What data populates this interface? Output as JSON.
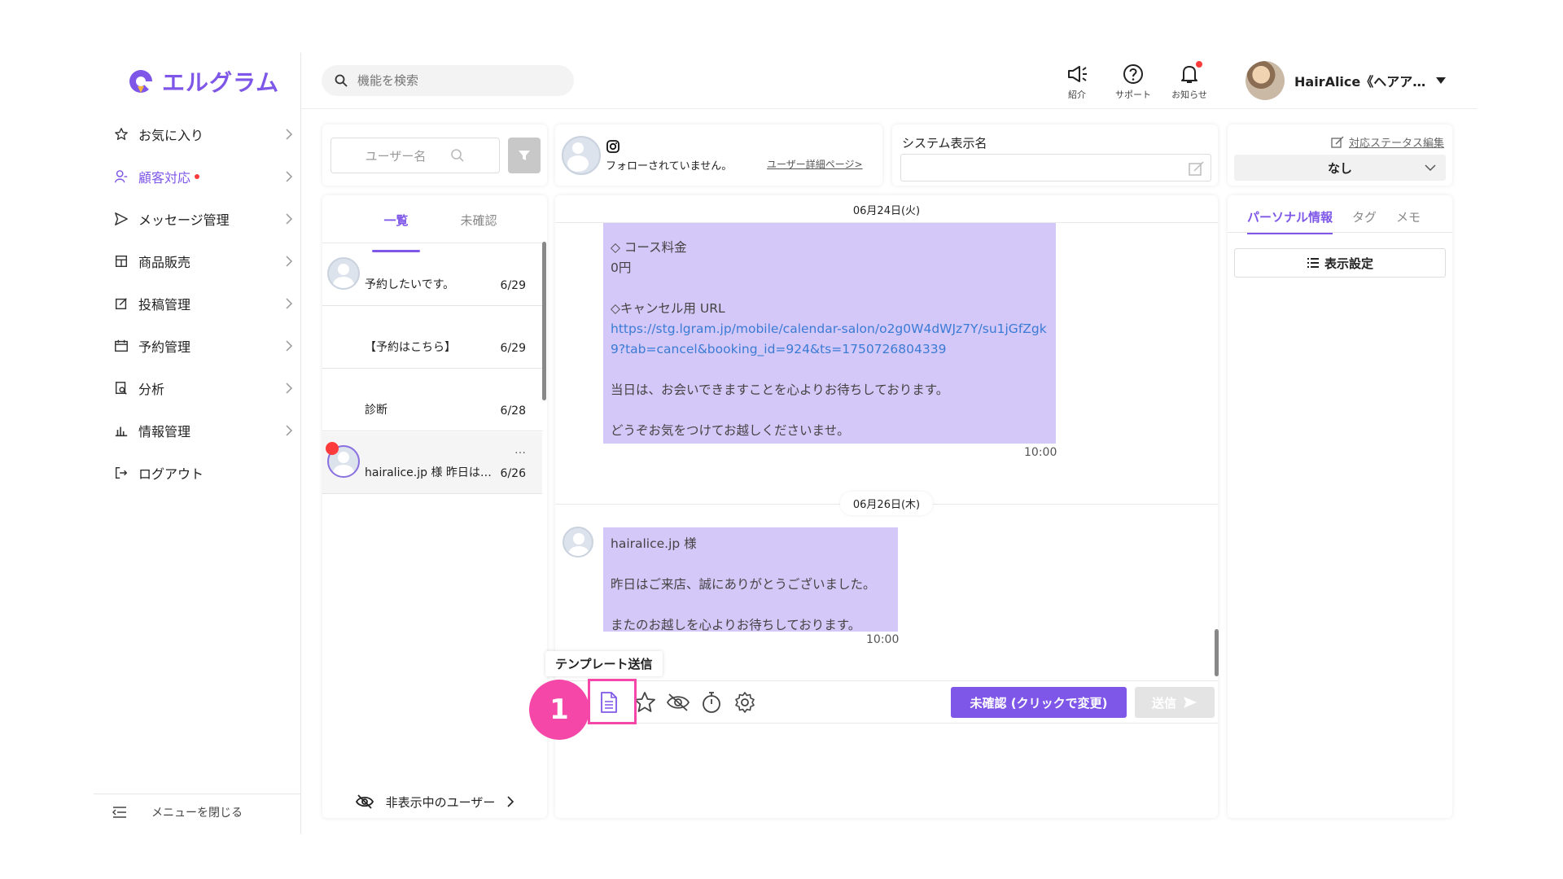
{
  "app": {
    "logo_text": "エルグラム"
  },
  "sidebar": {
    "items": [
      {
        "label": "お気に入り",
        "icon": "star-icon"
      },
      {
        "label": "顧客対応",
        "icon": "user-icon",
        "active": true,
        "badge": true
      },
      {
        "label": "メッセージ管理",
        "icon": "send-icon"
      },
      {
        "label": "商品販売",
        "icon": "shop-icon"
      },
      {
        "label": "投稿管理",
        "icon": "edit-icon"
      },
      {
        "label": "予約管理",
        "icon": "calendar-icon"
      },
      {
        "label": "分析",
        "icon": "analysis-icon"
      },
      {
        "label": "情報管理",
        "icon": "bar-chart-icon"
      },
      {
        "label": "ログアウト",
        "icon": "logout-icon"
      }
    ],
    "close_menu": "メニューを閉じる"
  },
  "header": {
    "search_placeholder": "機能を検索",
    "intro_label": "紹介",
    "support_label": "サポート",
    "notice_label": "お知らせ",
    "user_name": "HairAlice《ヘアア…"
  },
  "user_list": {
    "search_placeholder": "ユーザー名",
    "tab_all": "一覧",
    "tab_unconfirmed": "未確認",
    "rows": [
      {
        "text": "予約したいです。",
        "date": "6/29",
        "avatar": true
      },
      {
        "text": "【予約はこちら】",
        "date": "6/29",
        "avatar": false
      },
      {
        "text": "診断",
        "date": "6/28",
        "avatar": false
      },
      {
        "text": "hairalice.jp 様 昨日は…",
        "date": "6/26",
        "avatar": true,
        "unread": true,
        "more": "…"
      }
    ],
    "hidden_users": "非表示中のユーザー"
  },
  "profile": {
    "follow_status": "フォローされていません。",
    "detail_link": "ユーザー詳細ページ>"
  },
  "system_name": {
    "label": "システム表示名",
    "value": ""
  },
  "status": {
    "edit_link": "対応ステータス編集",
    "value": "なし"
  },
  "chat": {
    "date1": "06月24日(火)",
    "msg1": {
      "line1": "◇ コース料金",
      "line2": "0円",
      "line3": "◇キャンセル用 URL",
      "url1": "https://stg.lgram.jp/mobile/calendar-salon/o2g0W4dWJz7Y/su1jGfZgk",
      "url2": "9?tab=cancel&booking_id=924&ts=1750726804339",
      "line4": "当日は、お会いできますことを心よりお待ちしております。",
      "line5": "どうぞお気をつけてお越しくださいませ。",
      "time": "10:00"
    },
    "date2": "06月26日(木)",
    "msg2": {
      "line1": "hairalice.jp 様",
      "line2": "昨日はご来店、誠にありがとうございました。",
      "line3": "またのお越しを心よりお待ちしております。",
      "time": "10:00"
    },
    "tooltip": "テンプレート送信",
    "callout": "1",
    "unconfirmed_button": "未確認 (クリックで変更)",
    "send_button": "送信"
  },
  "info": {
    "tab_personal": "パーソナル情報",
    "tab_tag": "タグ",
    "tab_memo": "メモ",
    "display_settings": "表示設定"
  },
  "colors": {
    "accent": "#7e57e8",
    "bubble": "#d4c8f8",
    "callout": "#f447a8",
    "alert": "#ff3b3b"
  }
}
